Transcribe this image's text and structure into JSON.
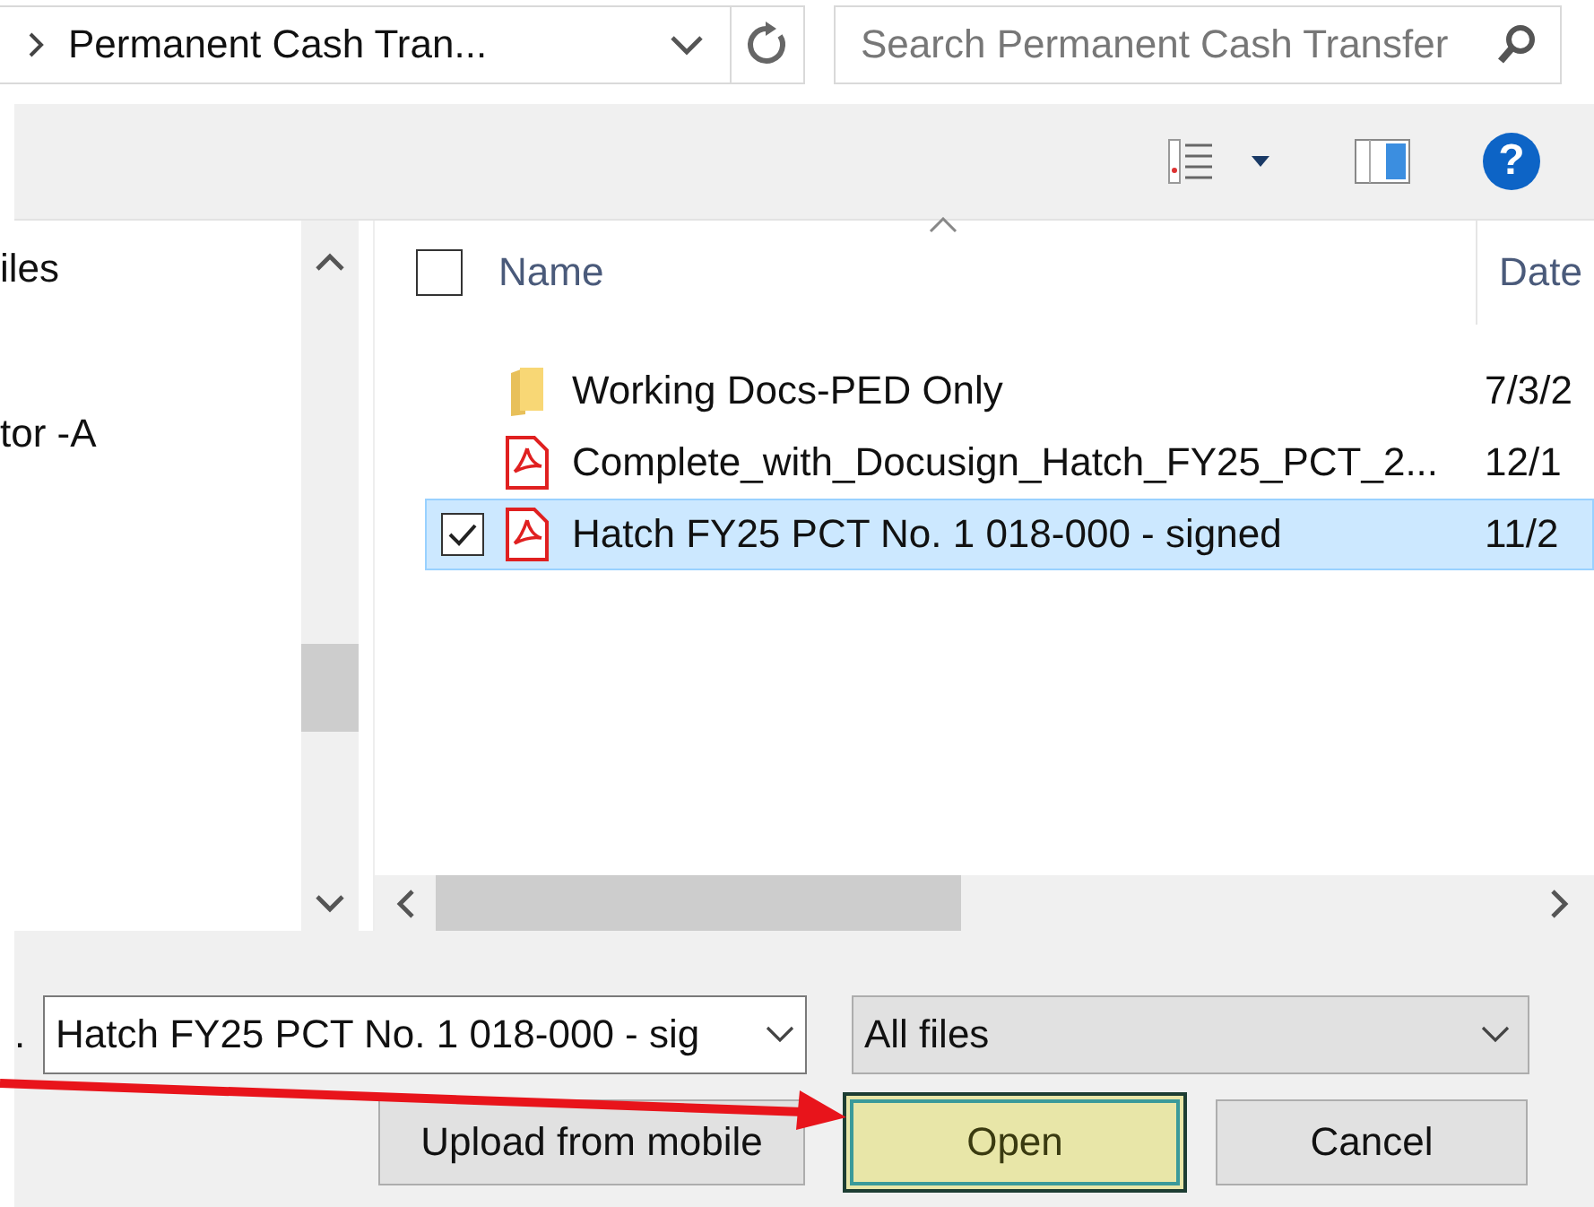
{
  "address": {
    "path": "Permanent Cash Tran..."
  },
  "search": {
    "placeholder": "Search Permanent Cash Transfer"
  },
  "toolbar": {
    "help": "?"
  },
  "sidebar": {
    "items": [
      {
        "label": "iles"
      },
      {
        "label": "tor -A"
      }
    ]
  },
  "file_list": {
    "select_all": {
      "checked": false
    },
    "columns": [
      {
        "label": "Name",
        "sorted": true
      },
      {
        "label": "Date",
        "sorted": false
      }
    ],
    "rows": [
      {
        "kind": "folder",
        "name": "Working Docs-PED Only",
        "date": "7/3/2",
        "selected": false,
        "checked": false
      },
      {
        "kind": "pdf",
        "name": "Complete_with_Docusign_Hatch_FY25_PCT_2...",
        "date": "12/1",
        "selected": false,
        "checked": false
      },
      {
        "kind": "pdf",
        "name": "Hatch FY25 PCT No. 1 018-000 - signed",
        "date": "11/2",
        "selected": true,
        "checked": true
      }
    ]
  },
  "footer": {
    "file_name_label": ".",
    "file_name": "Hatch FY25 PCT No. 1 018-000 - sig",
    "file_type": "All files",
    "buttons": [
      {
        "label": "Upload from mobile",
        "kind": "normal"
      },
      {
        "label": "Open",
        "kind": "highlighted"
      },
      {
        "label": "Cancel",
        "kind": "normal"
      }
    ]
  }
}
